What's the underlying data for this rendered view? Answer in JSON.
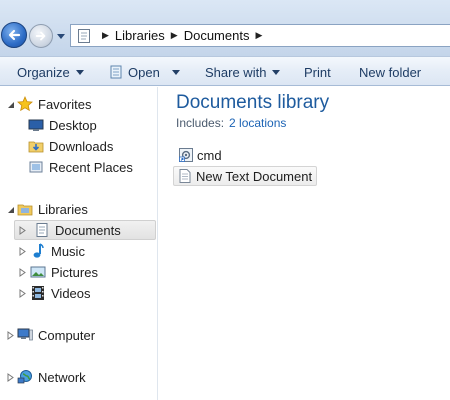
{
  "address_bar": {
    "breadcrumbs": [
      "Libraries",
      "Documents"
    ]
  },
  "toolbar": {
    "organize": "Organize",
    "open": "Open",
    "share_with": "Share with",
    "print": "Print",
    "new_folder": "New folder"
  },
  "nav": {
    "favorites": {
      "label": "Favorites",
      "items": [
        "Desktop",
        "Downloads",
        "Recent Places"
      ]
    },
    "libraries": {
      "label": "Libraries",
      "items": [
        "Documents",
        "Music",
        "Pictures",
        "Videos"
      ]
    },
    "computer": "Computer",
    "network": "Network"
  },
  "content": {
    "title": "Documents library",
    "includes_label": "Includes:",
    "includes_link": "2 locations",
    "files": [
      {
        "name": "cmd",
        "icon": "shortcut-app-icon"
      },
      {
        "name": "New Text Document",
        "icon": "text-file-icon"
      }
    ]
  }
}
